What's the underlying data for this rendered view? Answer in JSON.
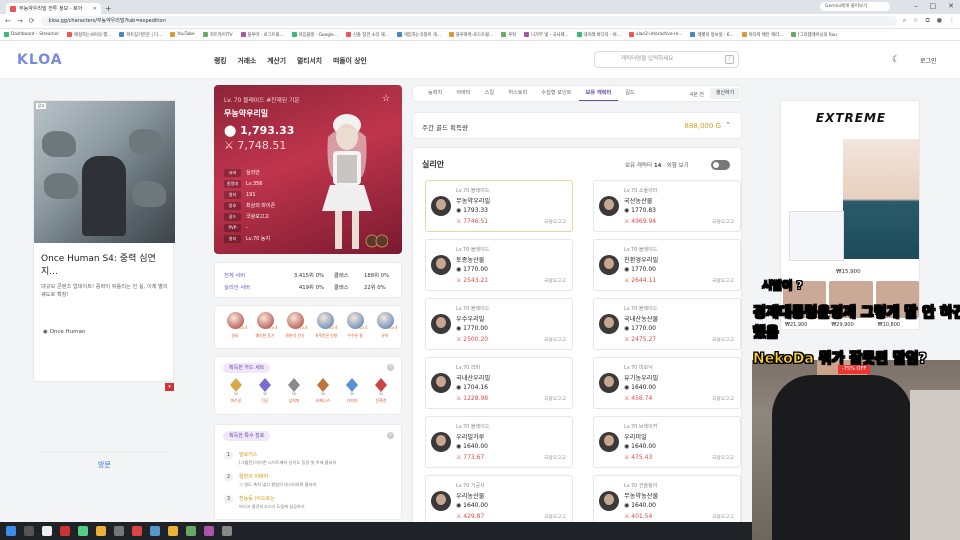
{
  "browser": {
    "tab_title": "무농약우리밀 전투 정보 - 로아",
    "url": "kloa.gg/characters/무농약우리밀?tab=expedition",
    "profile_label": "Gemini에게 물어보기",
    "bookmarks": [
      "Dashboard – Streamer",
      "애정하는사이의 행...",
      "파트장기본문 | 다...",
      "YouTube",
      "치트키/미TV",
      "블루마 - 로그트윗...",
      "자임블랭 - Google...",
      "신플 참견 소리 재...",
      "게임하는코뚱이 게...",
      "블루와룩-로드트윙...",
      "루팍",
      "나가부 빛 - 국사제...",
      "데이레 바다자 - 바...",
      "alan2-interactive-re...",
      "레펫의 정보실 : 6...",
      "이타워 배안 캐리...",
      "[그라템레이닝의 Rou"
    ]
  },
  "site": {
    "logo": "KLOA",
    "nav": [
      "랭킹",
      "거래소",
      "계산기",
      "멀티서치",
      "떠돌이 상인"
    ],
    "search_placeholder": "캐릭터명을 입력하세요",
    "search_key": "/",
    "login": "로그인"
  },
  "ad_left": {
    "tag": "광고",
    "title": "Once Human S4: 중력 심연 지...",
    "desc": "대규모 콘텐츠 업데이트! 중력이 뒤틀리는 진 실, 이제 별의 궤도로 확장!",
    "brand": "Once Human",
    "cta": "방문"
  },
  "hero": {
    "title": "Lv. 70 블레이드 #찬재된 기운",
    "name": "무농약우리밀",
    "item_level": "1,793.33",
    "combat_power": "7,748.51",
    "stats": [
      {
        "k": "서버",
        "v": "실리안"
      },
      {
        "k": "원정대",
        "v": "Lv.356"
      },
      {
        "k": "영지",
        "v": "191"
      },
      {
        "k": "칭호",
        "v": "최상의 마이존"
      },
      {
        "k": "길드",
        "v": "국왕모고고"
      },
      {
        "k": "PVP",
        "v": "-"
      },
      {
        "k": "영지",
        "v": "Lv.70 농지"
      }
    ]
  },
  "ranking": {
    "rows": [
      {
        "label": "전체 서버",
        "value": "3,415위 0%",
        "label2": "클래스",
        "value2": "188위 0%"
      },
      {
        "label": "실리안 서버",
        "value": "419위 0%",
        "label2": "클래스",
        "value2": "22위 0%"
      }
    ]
  },
  "engravings": [
    {
      "name": "실리",
      "lv": "Lv.4",
      "color": "#a33"
    },
    {
      "name": "예리한 둔기",
      "lv": "Lv.4",
      "color": "#a33"
    },
    {
      "name": "원한의 전기",
      "lv": "Lv.4",
      "color": "#a33"
    },
    {
      "name": "저주받은 인형",
      "lv": "Lv.4",
      "color": "#4474b8"
    },
    {
      "name": "우수한 결",
      "lv": "Lv.4",
      "color": "#4474b8"
    },
    {
      "name": "유아",
      "lv": "Lv.4",
      "color": "#4474b8"
    }
  ],
  "card_set": {
    "title": "획득한 카드 세트",
    "cards": [
      {
        "name": "파수꾼",
        "aw": "30"
      },
      {
        "name": "각군",
        "aw": "30"
      },
      {
        "name": "낯지파",
        "aw": "30"
      },
      {
        "name": "라제니스",
        "aw": "30"
      },
      {
        "name": "가져하",
        "aw": "30"
      },
      {
        "name": "진흑천",
        "aw": "30"
      }
    ]
  },
  "special_titles": {
    "title": "획득한 특수 칭호",
    "items": [
      {
        "num": "1",
        "name": "빌로어스",
        "desc": "[그룹전] 마이존 나이트메어 난이도 등장 첫 주에 클리어"
      },
      {
        "num": "2",
        "name": "절망의 지배자",
        "desc": "그 명도 축적 많고 평범의 마스터하며 클리어"
      },
      {
        "num": "3",
        "name": "전능등 (아드로는",
        "desc": "아디크 칼루리고스의 도움에 성공하기"
      }
    ]
  },
  "tabs": {
    "items": [
      "능력치",
      "아바타",
      "스킬",
      "히스토리",
      "수집형 포인트",
      "보유 캐릭터",
      "길드"
    ],
    "active_index": 5,
    "info": "4분 전",
    "refresh": "갱신하기"
  },
  "gold": {
    "label": "주간 골드 획득량",
    "value": "888,000 G"
  },
  "roster": {
    "server": "실리안",
    "holding_label": "보유 캐릭터",
    "holding_count": "14",
    "view_label": "외형 보기",
    "characters": [
      {
        "cls": "Lv.70 블레이드",
        "name": "무농약우리밀",
        "il": "1793.33",
        "cp": "7746.51",
        "srv": "국왕모고고",
        "sel": true
      },
      {
        "cls": "Lv.70 소울이터",
        "name": "국산농산물",
        "il": "1770.83",
        "cp": "4969.94",
        "srv": "국왕모고고"
      },
      {
        "cls": "Lv.70 블레이드",
        "name": "토종농산물",
        "il": "1770.00",
        "cp": "2543.21",
        "srv": "국왕모고고"
      },
      {
        "cls": "Lv.70 블레이드",
        "name": "친환경우리밀",
        "il": "1770.00",
        "cp": "2644.11",
        "srv": "국왕모고고"
      },
      {
        "cls": "Lv.70 블레이드",
        "name": "우수우리밀",
        "il": "1770.00",
        "cp": "2500.20",
        "srv": "국왕모고고"
      },
      {
        "cls": "Lv.70 블레이드",
        "name": "국내산농산물",
        "il": "1770.00",
        "cp": "2475.27",
        "srv": "국왕모고고"
      },
      {
        "cls": "Lv.70 리퍼",
        "name": "국내산우리밀",
        "il": "1704.16",
        "cp": "1228.98",
        "srv": "국왕모고고"
      },
      {
        "cls": "Lv.70 데모닉",
        "name": "유기농우리밀",
        "il": "1640.00",
        "cp": "456.74",
        "srv": "국왕모고고"
      },
      {
        "cls": "Lv.70 블레이드",
        "name": "우리밀가루",
        "il": "1640.00",
        "cp": "773.67",
        "srv": "국왕모고고"
      },
      {
        "cls": "Lv.70 브레이커",
        "name": "우리미일",
        "il": "1640.00",
        "cp": "475.43",
        "srv": "국왕모고고"
      },
      {
        "cls": "Lv.70 기공사",
        "name": "우리농산물",
        "il": "1640.00",
        "cp": "429.87",
        "srv": "국왕모고고"
      },
      {
        "cls": "Lv.70 건슬링어",
        "name": "무농약농산물",
        "il": "1640.00",
        "cp": "401.54",
        "srv": "국왕모고고"
      }
    ]
  },
  "ad_right": {
    "brand": "EXTREME",
    "price_main": "₩15,900",
    "thumb_prices": [
      "₩21,900",
      "₩29,900",
      "₩10,800"
    ]
  },
  "subtitles": {
    "line1a": "시발이 ?",
    "line2a": "경제대통령윤경제",
    "line2b": "그렇게 말 안 하긴",
    "line3": "했음",
    "line4a": "NekoDa",
    "line4b": "뭐가 잘못된 말임?",
    "badge": "-75% OFF"
  }
}
